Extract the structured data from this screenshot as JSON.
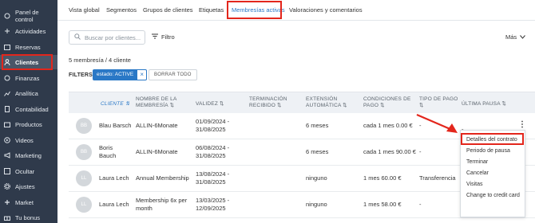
{
  "sidebar": {
    "items": [
      {
        "label": "Panel de control",
        "icon": "dashboard-icon"
      },
      {
        "label": "Actividades",
        "icon": "activity-icon"
      },
      {
        "label": "Reservas",
        "icon": "calendar-icon"
      },
      {
        "label": "Clientes",
        "icon": "user-icon",
        "active": true
      },
      {
        "label": "Finanzas",
        "icon": "euro-icon"
      },
      {
        "label": "Analítica",
        "icon": "chart-icon"
      },
      {
        "label": "Contabilidad",
        "icon": "document-icon"
      },
      {
        "label": "Productos",
        "icon": "box-icon"
      },
      {
        "label": "Videos",
        "icon": "play-icon"
      },
      {
        "label": "Marketing",
        "icon": "megaphone-icon"
      },
      {
        "label": "Ocultar",
        "icon": "hide-icon"
      },
      {
        "label": "Ajustes",
        "icon": "gear-icon"
      },
      {
        "label": "Market",
        "icon": "market-icon"
      },
      {
        "label": "Tu bonus",
        "icon": "gift-icon"
      }
    ]
  },
  "tabs": [
    "Vista global",
    "Segmentos",
    "Grupos de clientes",
    "Etiquetas",
    "Membresías activas",
    "Valoraciones y comentarios"
  ],
  "search": {
    "placeholder": "Buscar por clientes..."
  },
  "filter_label": "Filtro",
  "more_label": "Más",
  "count_text": "5 membresía / 4 cliente",
  "filters": {
    "label": "FILTERS",
    "chip": "estado: ACTIVE",
    "clear": "BORRAR TODO"
  },
  "table": {
    "headers": {
      "client": "CLIENTE",
      "membership": [
        "NOMBRE DE LA",
        "MEMBRESÍA"
      ],
      "validity": "VALIDEZ",
      "termination": [
        "TERMINACIÓN",
        "RECIBIDO"
      ],
      "extension": [
        "EXTENSIÓN",
        "AUTOMÁTICA"
      ],
      "payment_conditions": [
        "CONDICIONES DE",
        "PAGO"
      ],
      "payment_type": [
        "TIPO DE PAGO",
        ""
      ],
      "last_pause": "ÚLTIMA PAUSA"
    },
    "rows": [
      {
        "initials": "BB",
        "name": [
          "Blau Barsch",
          ""
        ],
        "membership": [
          "ALLIN-6Monate",
          ""
        ],
        "validity": [
          "01/09/2024 -",
          "31/08/2025"
        ],
        "extension": "6 meses",
        "payment": "cada 1 mes 0.00 €",
        "type": "-",
        "pause": "-"
      },
      {
        "initials": "BB",
        "name": [
          "Boris",
          "Bauch"
        ],
        "membership": [
          "ALLIN-6Monate",
          ""
        ],
        "validity": [
          "06/08/2024 -",
          "31/08/2025"
        ],
        "extension": "6 meses",
        "payment": "cada 1 mes 90.00 €",
        "type": "-",
        "pause": ""
      },
      {
        "initials": "LL",
        "name": [
          "Laura Lech",
          ""
        ],
        "membership": [
          "Annual Membership",
          ""
        ],
        "validity": [
          "13/08/2024 -",
          "31/08/2025"
        ],
        "extension": "ninguno",
        "payment": "1 mes 60.00 €",
        "type": "Transferencia",
        "pause": ""
      },
      {
        "initials": "LL",
        "name": [
          "Laura Lech",
          ""
        ],
        "membership": [
          "Membership 6x per",
          "month"
        ],
        "validity": [
          "13/03/2025 -",
          "12/09/2025"
        ],
        "extension": "ninguno",
        "payment": "1 mes 58.00 €",
        "type": "-",
        "pause": ""
      }
    ]
  },
  "menu": [
    "Detalles del contrato",
    "Periodo de pausa",
    "Terminar",
    "Cancelar",
    "Visitas",
    "Change to credit card"
  ],
  "colors": {
    "sidebar": "#2f3a4b",
    "accent": "#2a78c6",
    "highlight": "#e3261c"
  }
}
